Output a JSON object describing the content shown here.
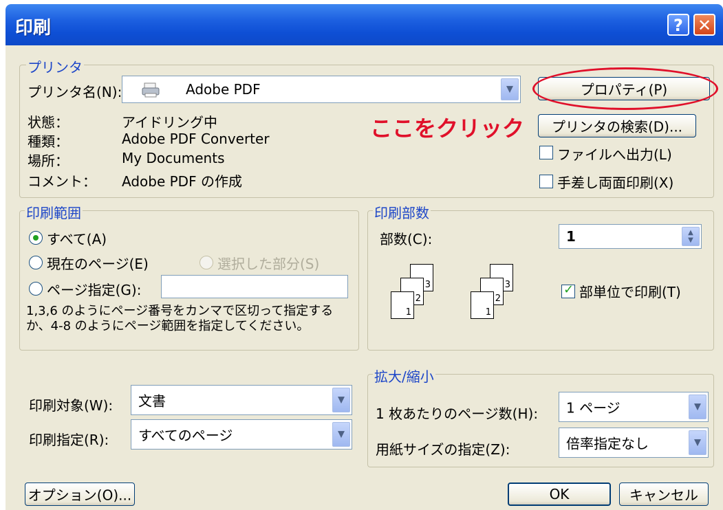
{
  "window": {
    "title": "印刷"
  },
  "titlebar": {
    "help_label": "?",
    "close_label": "✕"
  },
  "printer": {
    "group_label": "プリンタ",
    "name_label": "プリンタ名(N):",
    "name_value": "Adobe PDF",
    "status_label": "状態：",
    "status_value": "アイドリング中",
    "type_label": "種類：",
    "type_value": "Adobe PDF Converter",
    "location_label": "場所：",
    "location_value": "My Documents",
    "comment_label": "コメント：",
    "comment_value": "Adobe PDF の作成",
    "properties_button": "プロパティ(P)",
    "find_button": "プリンタの検索(D)...",
    "print_to_file_label": "ファイルへ出力(L)",
    "print_to_file_checked": false,
    "manual_duplex_label": "手差し両面印刷(X)",
    "manual_duplex_checked": false
  },
  "annotation": {
    "text": "ここをクリック",
    "color": "#e0102a"
  },
  "range": {
    "group_label": "印刷範囲",
    "all_label": "すべて(A)",
    "current_label": "現在のページ(E)",
    "selection_label": "選択した部分(S)",
    "pages_label": "ページ指定(G):",
    "pages_value": "",
    "hint": "1,3,6 のようにページ番号をカンマで区切って指定するか、4-8 のようにページ範囲を指定してください。",
    "selected": "all"
  },
  "copies": {
    "group_label": "印刷部数",
    "count_label": "部数(C):",
    "count_value": "1",
    "collate_label": "部単位で印刷(T)",
    "collate_checked": true,
    "page_numbers": [
      "1",
      "2",
      "3"
    ]
  },
  "print_what": {
    "label": "印刷対象(W):",
    "value": "文書"
  },
  "print_which": {
    "label": "印刷指定(R):",
    "value": "すべてのページ"
  },
  "zoom": {
    "group_label": "拡大/縮小",
    "pages_per_sheet_label": "1 枚あたりのページ数(H):",
    "pages_per_sheet_value": "1 ページ",
    "scale_label": "用紙サイズの指定(Z):",
    "scale_value": "倍率指定なし"
  },
  "footer": {
    "options_button": "オプション(O)...",
    "ok_button": "OK",
    "cancel_button": "キャンセル"
  }
}
